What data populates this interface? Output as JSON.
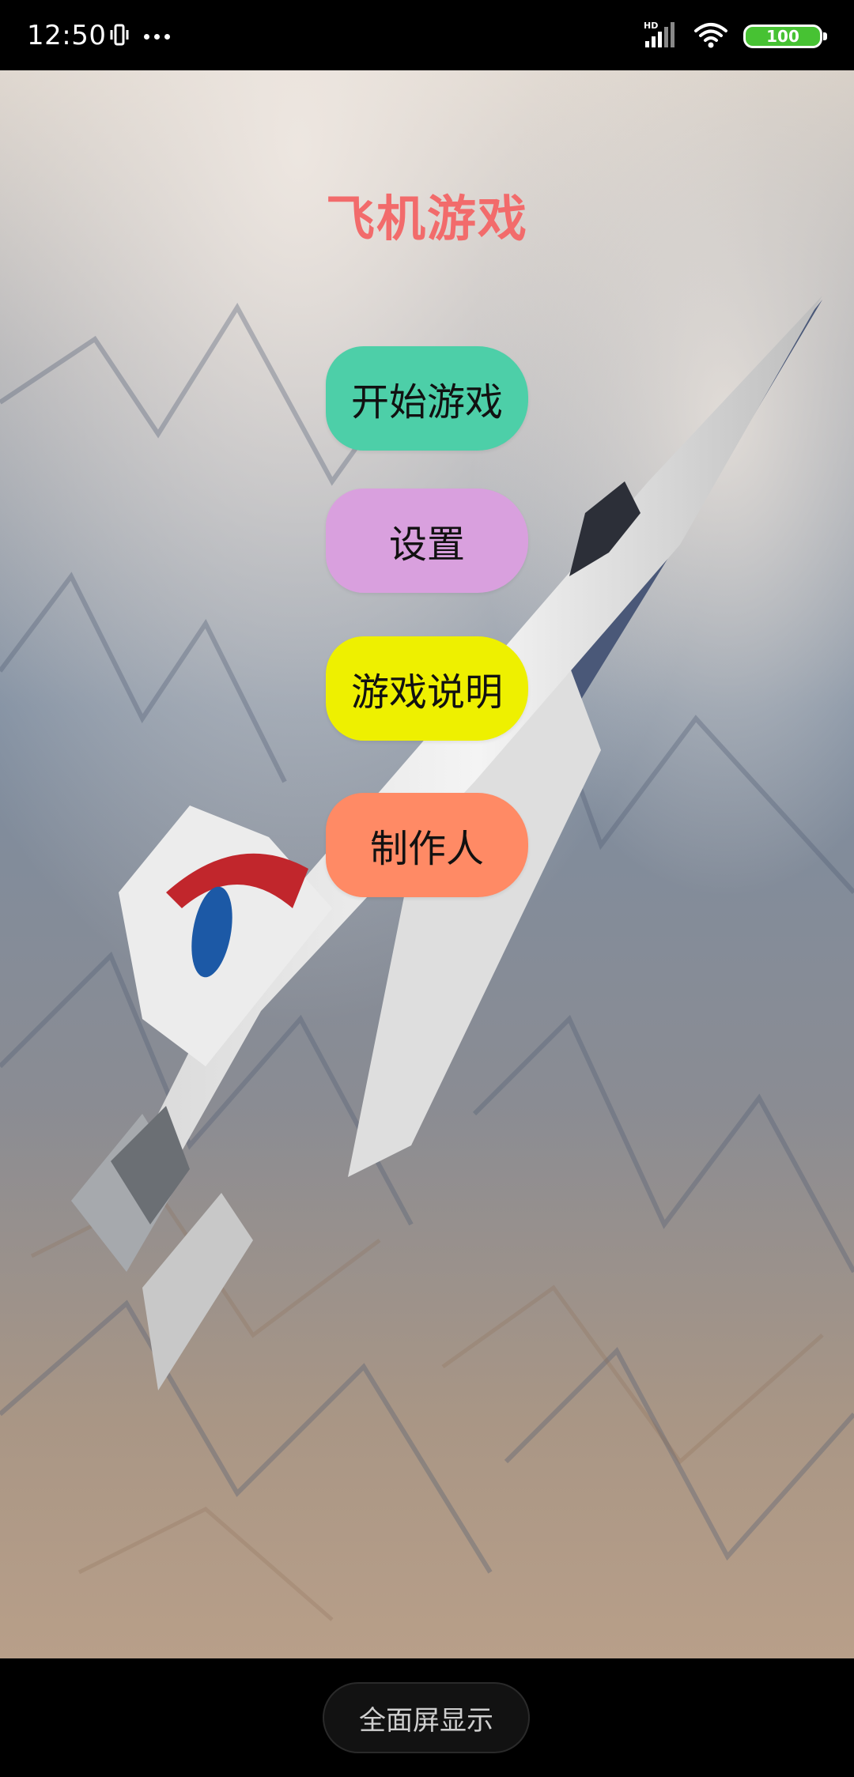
{
  "status_bar": {
    "time": "12:50",
    "left_icons": [
      "vibrate-icon",
      "more-dots-icon"
    ],
    "right_icons": [
      "hd-signal-icon",
      "wifi-icon",
      "battery-icon"
    ],
    "signal_label": "HD",
    "battery_level": "100",
    "battery_color": "#47c233"
  },
  "app": {
    "title": "飞机游戏",
    "title_color": "#f26b6b",
    "background": "aircraft-over-mountains-image",
    "buttons": [
      {
        "label": "开始游戏",
        "color": "#4dcfa8"
      },
      {
        "label": "设置",
        "color": "#d9a0de"
      },
      {
        "label": "游戏说明",
        "color": "#eef000"
      },
      {
        "label": "制作人",
        "color": "#ff8a65"
      }
    ]
  },
  "bottom_bar": {
    "fullscreen_label": "全面屏显示"
  }
}
